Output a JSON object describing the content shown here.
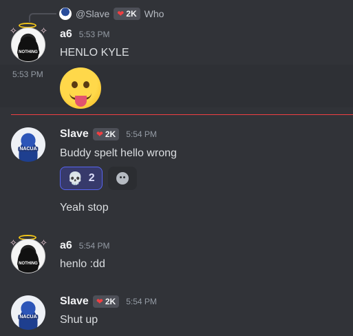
{
  "reply": {
    "mention": "@Slave",
    "badge_count": "2K",
    "text": "Who"
  },
  "messages": [
    {
      "author": "a6",
      "time": "5:53 PM",
      "text": "HENLO KYLE",
      "avatar_tag": "NOTHING"
    },
    {
      "time": "5:53 PM",
      "emoji": "stuck-out-tongue"
    },
    {
      "author": "Slave",
      "badge_count": "2K",
      "time": "5:54 PM",
      "text": "Buddy spelt hello wrong",
      "avatar_tag": "NACUA",
      "reaction": {
        "emoji": "skull",
        "count": "2"
      },
      "text2": "Yeah stop"
    },
    {
      "author": "a6",
      "time": "5:54 PM",
      "text": "henlo :dd",
      "avatar_tag": "NOTHING"
    },
    {
      "author": "Slave",
      "badge_count": "2K",
      "time": "5:54 PM",
      "text": "Shut up",
      "avatar_tag": "NACUA"
    }
  ],
  "colors": {
    "background": "#313338",
    "new_message_divider": "#f23f42",
    "reaction_accent": "#5865f2"
  }
}
